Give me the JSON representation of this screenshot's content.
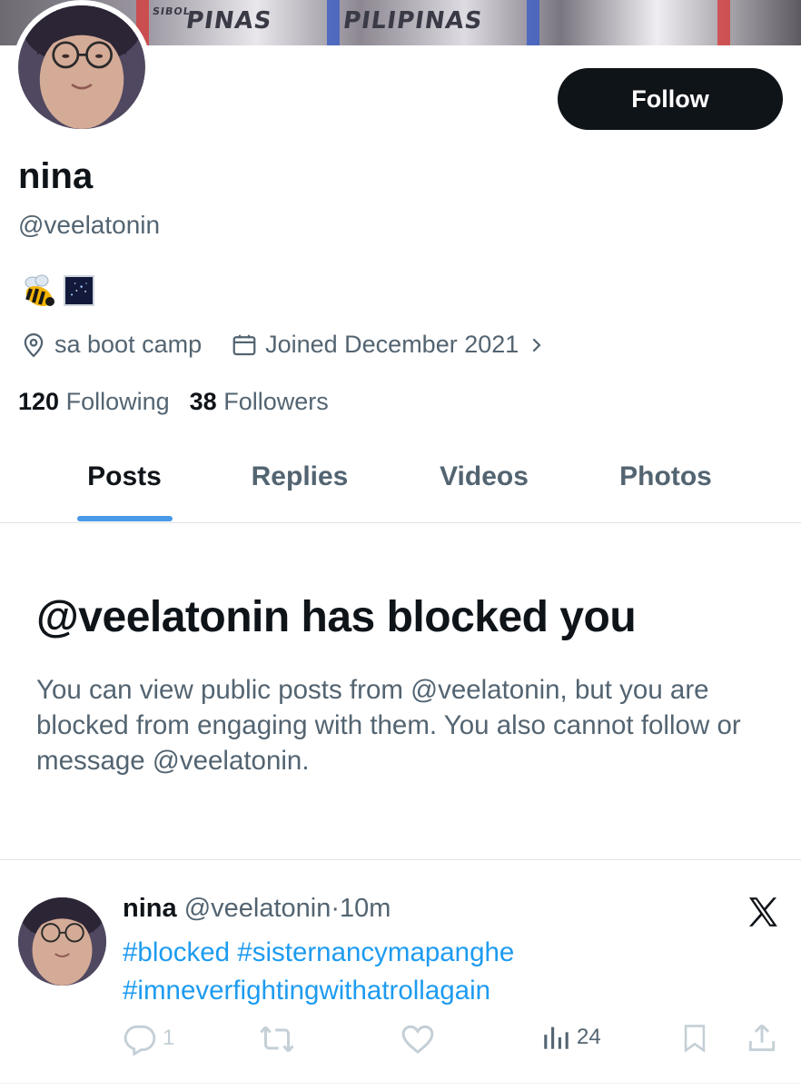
{
  "profile": {
    "display_name": "nina",
    "handle": "@veelatonin",
    "follow_label": "Follow",
    "location": "sa boot camp",
    "joined": "Joined December 2021",
    "following_count": "120",
    "following_label": "Following",
    "followers_count": "38",
    "followers_label": "Followers"
  },
  "banner": {
    "jersey_texts": [
      "SIBOL",
      "PINAS",
      "PILIPINAS"
    ]
  },
  "tabs": [
    {
      "label": "Posts",
      "active": true
    },
    {
      "label": "Replies",
      "active": false
    },
    {
      "label": "Videos",
      "active": false
    },
    {
      "label": "Photos",
      "active": false
    }
  ],
  "blocked": {
    "title": "@veelatonin has blocked you",
    "description": "You can view public posts from @veelatonin, but you are blocked from engaging with them. You also cannot follow or message @veelatonin."
  },
  "post": {
    "name": "nina",
    "handle": "@veelatonin",
    "separator": "·",
    "time": "10m",
    "hashtags": [
      "#blocked #sisternancymapanghe",
      "#imneverfightingwithatrollagain"
    ],
    "reply_count": "1",
    "views_count": "24"
  },
  "icons": {
    "location": "location-pin-icon",
    "calendar": "calendar-icon",
    "chevron": "chevron-right-icon",
    "x_logo": "x-logo-icon",
    "reply": "reply-icon",
    "repost": "repost-icon",
    "like": "heart-icon",
    "views": "views-icon",
    "bookmark": "bookmark-icon",
    "share": "share-icon"
  },
  "colors": {
    "follow_bg": "#0f1419",
    "tab_indicator": "#4a99e9",
    "link_blue": "#1d9bf0",
    "secondary_text": "#536471"
  }
}
